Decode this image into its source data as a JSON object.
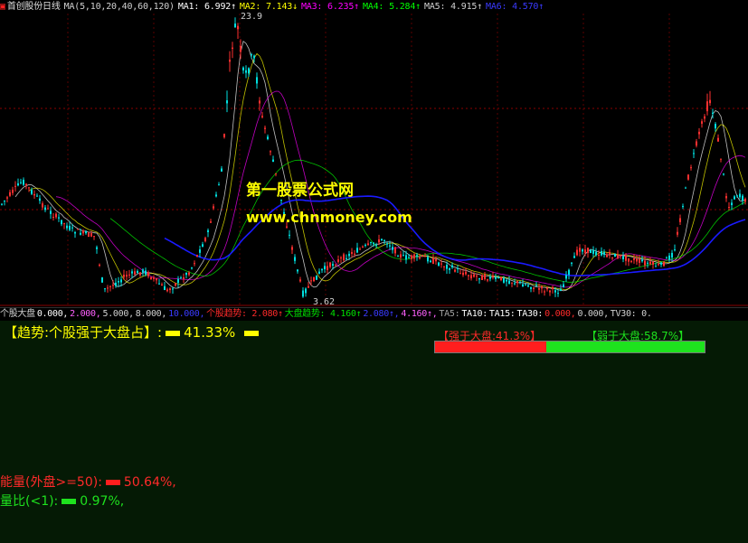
{
  "header": {
    "stock_name": "首创股份",
    "period": "日线",
    "ma_params": "MA(5,10,20,40,60,120)",
    "ma1": "MA1: 6.992↑",
    "ma2": "MA2: 7.143↓",
    "ma3": "MA3: 6.235↑",
    "ma4": "MA4: 5.284↑",
    "ma5": "MA5: 4.915↑",
    "ma6": "MA6: 4.570↑"
  },
  "chart_labels": {
    "high_price": "23.9",
    "low_price": "3.62"
  },
  "watermark": {
    "line1": "第一股票公式网",
    "line2": "www.chnmoney.com"
  },
  "indicator_bar": {
    "name": "个股大盘",
    "v1": "0.000,",
    "v2": "2.000,",
    "v3": "5.000,",
    "v4": "8.000,",
    "v5": "10.000,",
    "stock_trend": "个股趋势: 2.080↑",
    "market_trend": "大盘趋势: 4.160↑",
    "v6": "2.080↑,",
    "v7": "4.160↑,",
    "ta5": "TA5:",
    "ta10": "TA10:",
    "ta15": "TA15:",
    "ta30": "TA30:",
    "v8": "0.000,",
    "v9": "0.000,",
    "tv30": "TV30: 0."
  },
  "panel": {
    "trend_label": "【趋势:个股强于大盘占】:",
    "trend_value": "41.33%",
    "stronger_label": "【强于大盘:41.3%】",
    "weaker_label": "【弱于大盘:58.7%】",
    "energy_label": "能量(外盘>=50):",
    "energy_value": "50.64%,",
    "volratio_label": "量比(<1):",
    "volratio_value": "0.97%,",
    "stronger_pct": 41.3,
    "weaker_pct": 58.7
  },
  "colors": {
    "red": "#ff2a2a",
    "green": "#1ee21e",
    "yellow": "#ffff00",
    "blue": "#2020ff",
    "panel_bg": "#051a05"
  }
}
